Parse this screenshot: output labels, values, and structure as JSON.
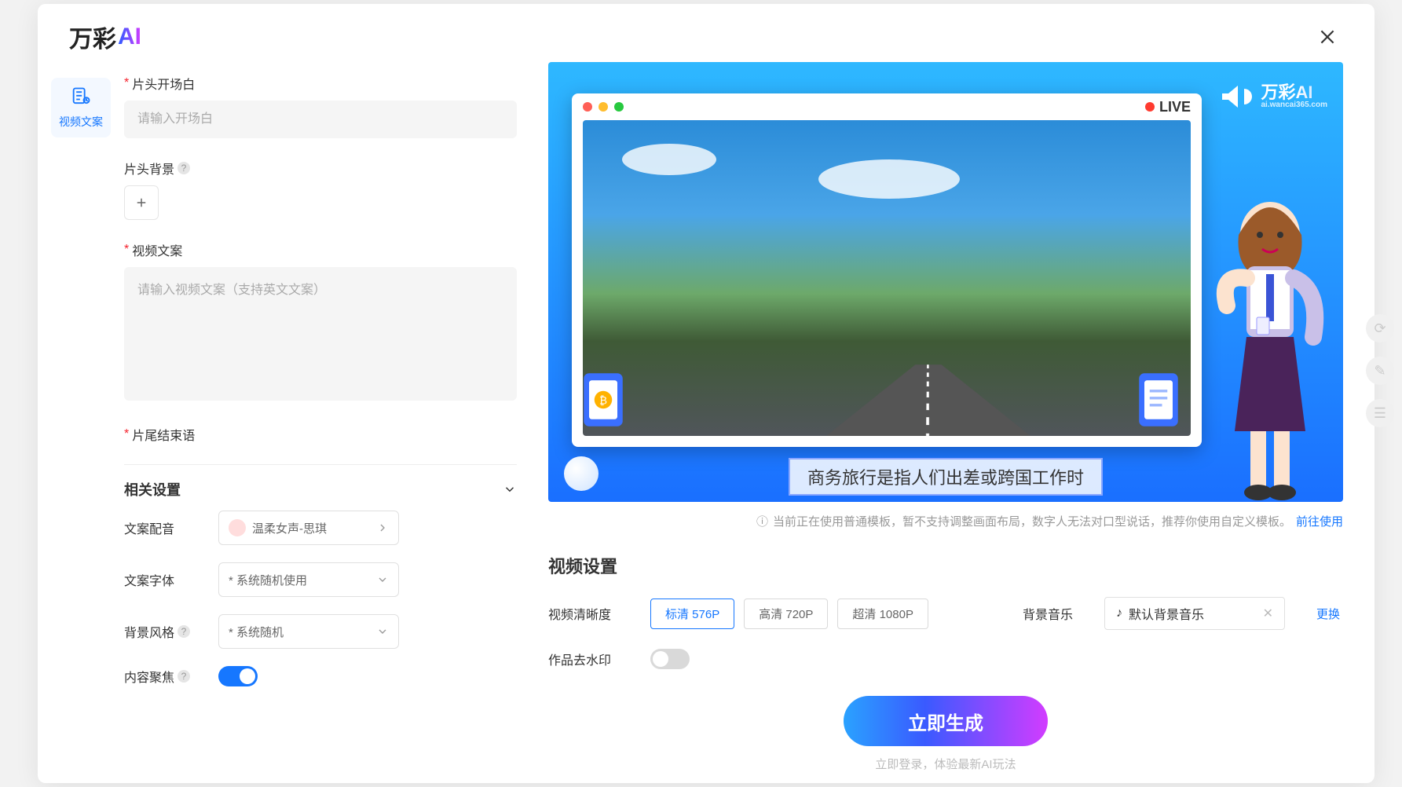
{
  "brand": {
    "cn": "万彩",
    "en": "AI"
  },
  "leftRail": {
    "videoScript": "视频文案"
  },
  "form": {
    "opening": {
      "label": "片头开场白",
      "placeholder": "请输入开场白"
    },
    "openingBg": {
      "label": "片头背景"
    },
    "script": {
      "label": "视频文案",
      "placeholder": "请输入视频文案（支持英文文案）"
    },
    "ending": {
      "label": "片尾结束语"
    }
  },
  "settings": {
    "title": "相关设置",
    "voice": {
      "label": "文案配音",
      "selected": "温柔女声-思琪"
    },
    "font": {
      "label": "文案字体",
      "selected": "* 系统随机使用"
    },
    "bgStyle": {
      "label": "背景风格",
      "selected": "* 系统随机"
    },
    "focus": {
      "label": "内容聚焦"
    }
  },
  "preview": {
    "live": "LIVE",
    "brand": {
      "cn": "万彩",
      "en": "AI",
      "sub": "ai.wancai365.com"
    },
    "subtitle": "商务旅行是指人们出差或跨国工作时",
    "tipIcon": "ⓘ",
    "tipText": "当前正在使用普通模板，暂不支持调整画面布局，数字人无法对口型说话，推荐你使用自定义模板。",
    "tipLink": "前往使用"
  },
  "videoSettings": {
    "title": "视频设置",
    "resolution": {
      "label": "视频清晰度",
      "opts": [
        "标清 576P",
        "高清 720P",
        "超清 1080P"
      ],
      "selected": 0
    },
    "music": {
      "label": "背景音乐",
      "noteIcon": "♪",
      "selected": "默认背景音乐",
      "change": "更换"
    },
    "watermark": {
      "label": "作品去水印"
    }
  },
  "actions": {
    "generate": "立即生成",
    "loginTip": "立即登录，体验最新AI玩法"
  }
}
